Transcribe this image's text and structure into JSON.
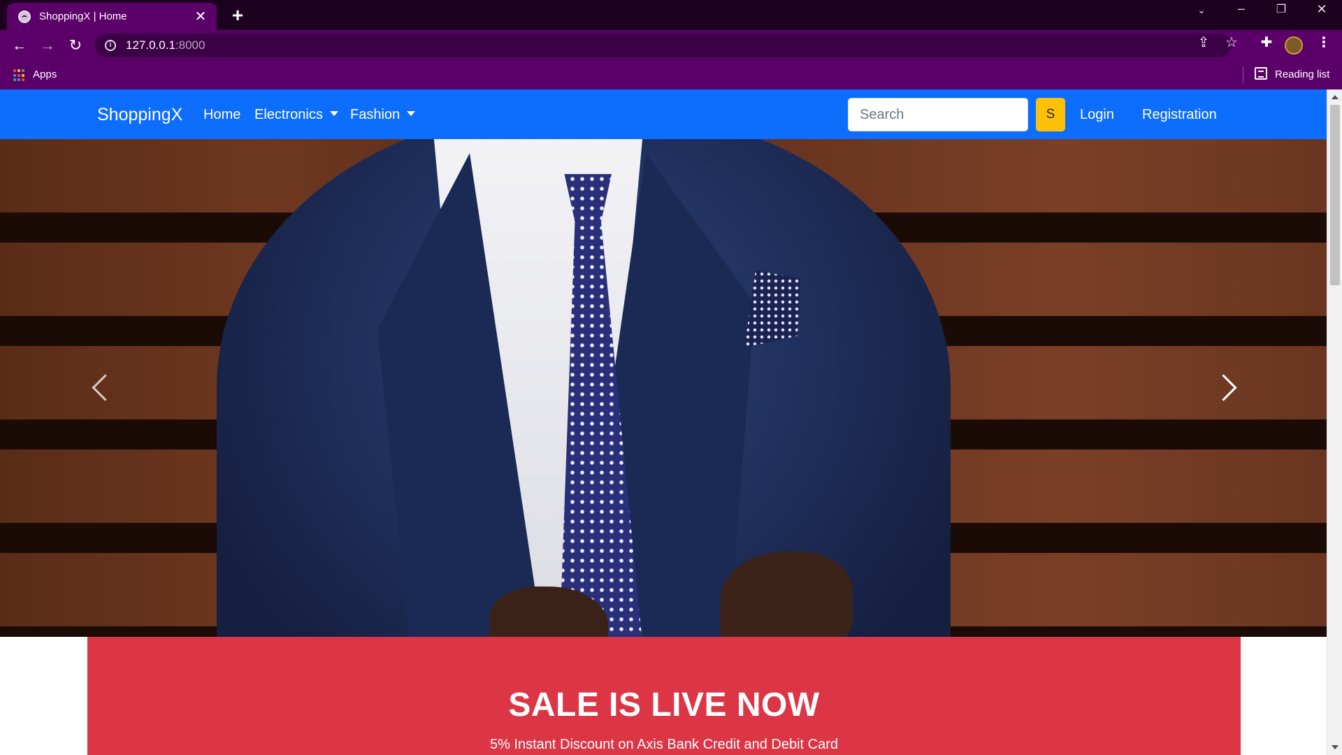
{
  "browser": {
    "tab_title": "ShoppingX | Home",
    "tab_close": "✕",
    "new_tab": "+",
    "url_host": "127.0.0.1",
    "url_port": ":8000",
    "bookmarks_apps": "Apps",
    "reading_list": "Reading list",
    "icons": [
      "back-arrow-icon",
      "forward-arrow-icon",
      "reload-icon",
      "site-info-icon",
      "share-icon",
      "bookmark-star-icon",
      "extensions-icon",
      "profile-avatar",
      "more-menu-icon",
      "reading-list-icon",
      "apps-grid-icon"
    ],
    "theme_colors": {
      "tabstrip": "#1d001f",
      "toolbar": "#5c0069"
    }
  },
  "navbar": {
    "brand": "ShoppingX",
    "home": "Home",
    "electronics": "Electronics",
    "fashion": "Fashion",
    "search_placeholder": "Search",
    "search_button": "S",
    "login": "Login",
    "registration": "Registration",
    "colors": {
      "navbar": "#0d6efd",
      "search_button": "#ffc107"
    }
  },
  "carousel": {
    "image_subject": "man in navy suit with polka-dot tie against wooden wall",
    "prev_icon": "chevron-left-icon",
    "next_icon": "chevron-right-icon"
  },
  "sale": {
    "title": "SALE IS LIVE NOW",
    "subtitle": "5% Instant Discount on Axis Bank Credit and Debit Card",
    "color": "#dc3545"
  }
}
